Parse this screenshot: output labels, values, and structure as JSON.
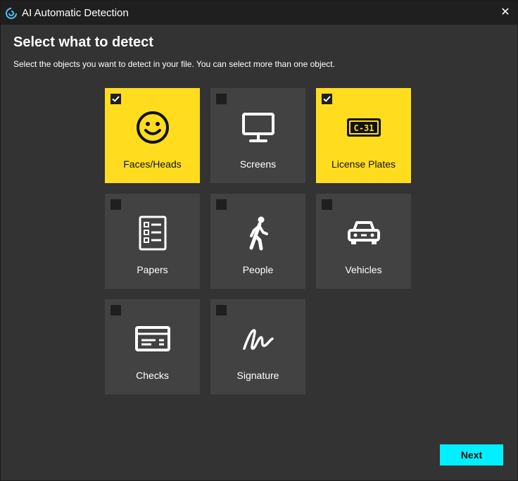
{
  "window": {
    "title": "AI Automatic Detection",
    "close_glyph": "✕",
    "logo_icon": "app-swirl-icon"
  },
  "header": {
    "heading": "Select what to detect",
    "subtitle": "Select the objects you want to detect in your file. You can select more than one object."
  },
  "options": [
    {
      "label": "Faces/Heads",
      "icon": "smiley-face-icon",
      "checked": true
    },
    {
      "label": "Screens",
      "icon": "monitor-icon",
      "checked": false
    },
    {
      "label": "License Plates",
      "icon": "license-plate-icon",
      "checked": true,
      "plate_text": "C-31"
    },
    {
      "label": "Papers",
      "icon": "document-list-icon",
      "checked": false
    },
    {
      "label": "People",
      "icon": "walking-person-icon",
      "checked": false
    },
    {
      "label": "Vehicles",
      "icon": "car-icon",
      "checked": false
    },
    {
      "label": "Checks",
      "icon": "bank-check-icon",
      "checked": false
    },
    {
      "label": "Signature",
      "icon": "signature-icon",
      "checked": false
    }
  ],
  "footer": {
    "next_label": "Next"
  },
  "colors": {
    "selected_tile": "#ffdd1e",
    "tile": "#424242",
    "background": "#333333",
    "titlebar": "#1f1f1f",
    "next_button": "#00f0ff"
  }
}
